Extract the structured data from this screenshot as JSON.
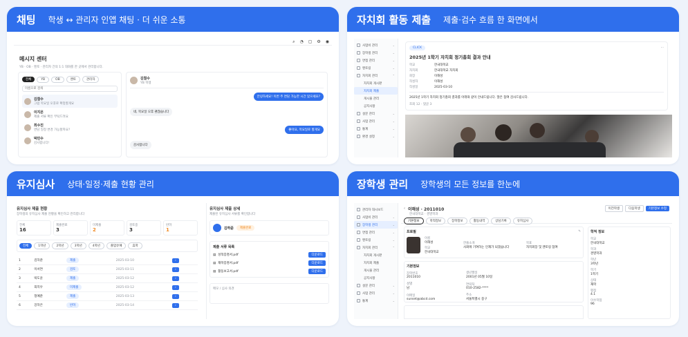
{
  "cards": [
    {
      "title": "채팅",
      "subtitle": "학생 ↔ 관리자 인앱 채팅 · 더 쉬운 소통"
    },
    {
      "title": "자치회 활동 제출",
      "subtitle": "제출·검수 흐름 한 화면에서"
    },
    {
      "title": "유지심사",
      "subtitle": "상태·일정·제출 현황 관리"
    },
    {
      "title": "장학생 관리",
      "subtitle": "장학생의 모든 정보를 한눈에"
    }
  ],
  "chat": {
    "title": "메시지 센터",
    "desc": "YB · OB · 멘토 · 관리자 간의 1:1 대화를 한 곳에서 관리합니다.",
    "tabs": [
      "전체",
      "YB",
      "OB",
      "멘토",
      "관리자"
    ],
    "search_placeholder": "이름으로 검색",
    "contacts": [
      {
        "name": "김철수",
        "msg": "그럼 목요일 오후로 확정할게요"
      },
      {
        "name": "이지은",
        "msg": "제출 서류 확인 부탁드려요"
      },
      {
        "name": "최수진",
        "msg": "면담 일정 변경 가능할까요?"
      },
      {
        "name": "박민수",
        "msg": "감사합니다!"
      }
    ],
    "peer": {
      "name": "김철수",
      "role": "YB 학생"
    },
    "messages": [
      {
        "side": "r",
        "text": "안녕하세요! 이번 주 면담 가능한 시간 있으세요?"
      },
      {
        "side": "l",
        "text": "네, 목요일 오후 괜찮습니다"
      },
      {
        "side": "r",
        "text": "좋아요, 목요일로 할게요"
      },
      {
        "side": "l",
        "text": "감사합니다"
      }
    ]
  },
  "council": {
    "badge": "CLICK",
    "title": "2025년 1학기 자치회 정기총회 결과 안내",
    "fields": [
      {
        "k": "학교",
        "v": "한국대학교"
      },
      {
        "k": "자치회",
        "v": "한국대학교 자치회"
      },
      {
        "k": "회장",
        "v": "이해성"
      },
      {
        "k": "작성자",
        "v": "이해성"
      },
      {
        "k": "작성일",
        "v": "2025-03-10"
      }
    ],
    "body": "2025년 1학기 자치회 정기총회 결과를 아래와 같이 안내드립니다. 많은 참여 감사드립니다.",
    "stats": "조회 12 · 댓글 3",
    "side_items": [
      "사업비 관리",
      "장학생 관리",
      "면접 관리",
      "멘토링",
      "자치회 관리",
      "자치회 게시판",
      "자치회 제출",
      "게시물 관리",
      "공지사항",
      "설문 관리",
      "사업 관리",
      "통계",
      "환경 설정"
    ],
    "side_active": "자치회 제출"
  },
  "review": {
    "list_title": "유지심사 제출 현황",
    "list_sub": "장학생의 유지심사 제출 현황을 확인하고 관리합니다",
    "stats": [
      {
        "label": "전체",
        "value": "16"
      },
      {
        "label": "제출완료",
        "value": "3"
      },
      {
        "label": "미제출",
        "value": "2"
      },
      {
        "label": "검토중",
        "value": "3"
      },
      {
        "label": "반려",
        "value": "1"
      }
    ],
    "filters": [
      "전체",
      "1학년",
      "2학년",
      "3학년",
      "4학년",
      "졸업유예",
      "휴학"
    ],
    "rows": [
      {
        "no": "1",
        "name": "김하준",
        "status": "제출",
        "date": "2025-03-10"
      },
      {
        "no": "2",
        "name": "이서연",
        "status": "검토",
        "date": "2025-03-11"
      },
      {
        "no": "3",
        "name": "박도윤",
        "status": "제출",
        "date": "2025-03-12"
      },
      {
        "no": "4",
        "name": "최지우",
        "status": "미제출",
        "date": "2025-03-12"
      },
      {
        "no": "5",
        "name": "정예준",
        "status": "제출",
        "date": "2025-03-13"
      },
      {
        "no": "6",
        "name": "강하은",
        "status": "반려",
        "date": "2025-03-14"
      }
    ],
    "detail_title": "유지심사 제출 상세",
    "detail_sub": "제출된 유지심사 서류를 확인합니다",
    "detail_name": "김하준",
    "detail_status": "제출완료",
    "detail_section": "제출 서류 목록",
    "detail_files": [
      "성적증명서.pdf",
      "재학증명서.pdf",
      "활동보고서.pdf"
    ],
    "detail_btn": "다운로드",
    "detail_memo": "메모 / 심사 의견"
  },
  "scholar": {
    "name": "이해성 · 2011010",
    "sub": "한국대학교 · 경영학과",
    "tabs": [
      "기본정보",
      "학적정보",
      "장학정보",
      "활동내역",
      "상담기록",
      "유지심사"
    ],
    "actions": [
      "이전학생",
      "다음학생",
      "기본정보 수정"
    ],
    "profile_title": "프로필",
    "profile": [
      {
        "k": "이름",
        "v": "이해성"
      },
      {
        "k": "학교",
        "v": "한국대학교"
      },
      {
        "k": "한줄소개",
        "v": "사회에 기여하는 인재가 되겠습니다"
      },
      {
        "k": "목표",
        "v": "자치회장 및 멘토링 참여"
      }
    ],
    "basic_title": "기본정보",
    "basic": [
      {
        "k": "장학번호",
        "v": "2011010"
      },
      {
        "k": "생년월일",
        "v": "2001년 05월 10일"
      },
      {
        "k": "성별",
        "v": "남"
      },
      {
        "k": "연락처",
        "v": "010-2582-****"
      },
      {
        "k": "이메일",
        "v": "sunset@abcd.com"
      },
      {
        "k": "주소",
        "v": "서울특별시 중구"
      }
    ],
    "right_title": "학적 정보",
    "right": [
      {
        "k": "학교",
        "v": "한국대학교"
      },
      {
        "k": "학과",
        "v": "경영학과"
      },
      {
        "k": "학년",
        "v": "3학년"
      },
      {
        "k": "학기",
        "v": "1학기"
      },
      {
        "k": "상태",
        "v": "재학"
      },
      {
        "k": "평점",
        "v": "4.1"
      },
      {
        "k": "이수학점",
        "v": "96"
      }
    ],
    "side_items": [
      "관리자 대시보드",
      "사업비 관리",
      "장학생 관리",
      "면접 관리",
      "멘토링",
      "자치회 관리",
      "자치회 게시판",
      "자치회 제출",
      "게시물 관리",
      "공지사항",
      "설문 관리",
      "사업 관리",
      "통계"
    ],
    "side_active": "장학생 관리"
  }
}
